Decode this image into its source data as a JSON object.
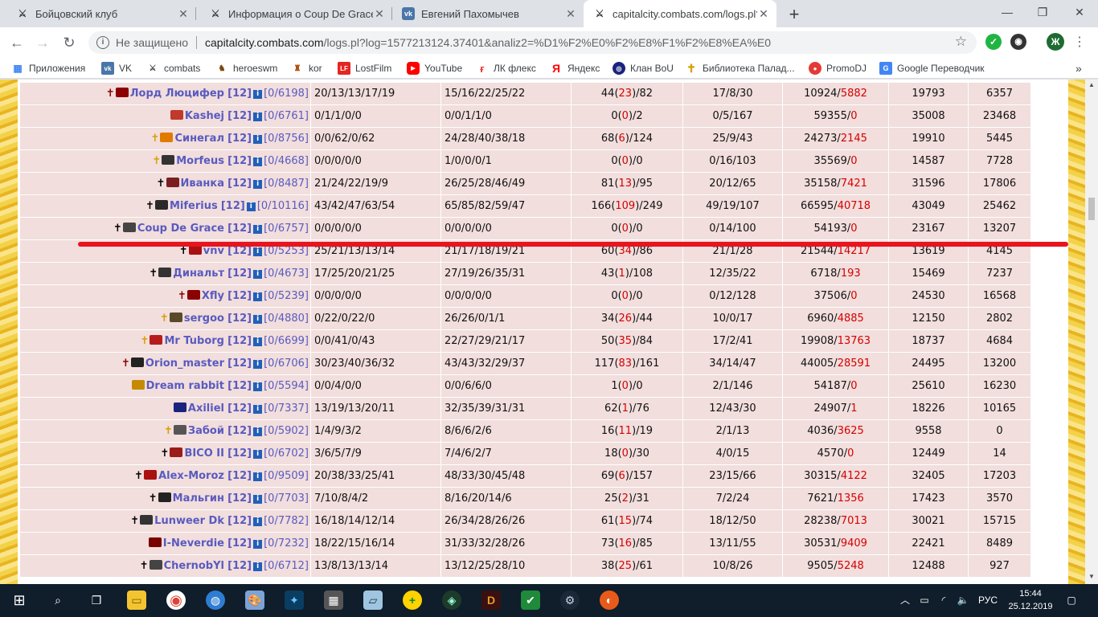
{
  "browser": {
    "tabs": [
      {
        "title": "Бойцовский клуб",
        "icon": "crossed-swords-icon"
      },
      {
        "title": "Информация о Coup De Grace",
        "icon": "crossed-swords-icon"
      },
      {
        "title": "Евгений Пахомычев",
        "icon": "vk-icon"
      },
      {
        "title": "capitalcity.combats.com/logs.pl?l",
        "icon": "crossed-swords-icon"
      }
    ],
    "new_tab": "+",
    "window_controls": [
      "—",
      "❐",
      "✕"
    ],
    "security_label": "Не защищено",
    "url_host": "capitalcity.combats.com",
    "url_path": "/logs.pl?log=1577213124.37401&analiz2=%D1%F2%E0%F2%E8%F1%F2%E8%EA%E0",
    "profile_letter": "Ж"
  },
  "bookmarks": [
    {
      "label": "Приложения",
      "icon": "apps-grid-icon"
    },
    {
      "label": "VK",
      "icon": "vk-icon"
    },
    {
      "label": "combats",
      "icon": "crossed-swords-icon"
    },
    {
      "label": "heroeswm",
      "icon": "horse-icon"
    },
    {
      "label": "kor",
      "icon": "castle-icon"
    },
    {
      "label": "LostFilm",
      "icon": "lostfilm-icon"
    },
    {
      "label": "YouTube",
      "icon": "youtube-icon"
    },
    {
      "label": "ЛК флекс",
      "icon": "flex-icon"
    },
    {
      "label": "Яндекс",
      "icon": "yandex-icon"
    },
    {
      "label": "Клан BoU",
      "icon": "clan-icon"
    },
    {
      "label": "Библиотека Палад...",
      "icon": "cross-icon"
    },
    {
      "label": "PromoDJ",
      "icon": "promodj-icon"
    },
    {
      "label": "Google Переводчик",
      "icon": "translate-icon"
    }
  ],
  "log_rows": [
    {
      "align": "✝",
      "align_color": "#8b0000",
      "login": "Лорд Люцифер",
      "level": "[12]",
      "hp": "[0/6198]",
      "s1": "20/13/13/17/19",
      "s2": "15/16/22/25/22",
      "d1": "44(",
      "d2": "23",
      "d3": ")/82",
      "kills": "17/8/30",
      "e1": "10924/",
      "e2": "5882",
      "n1": "19793",
      "n2": "6357"
    },
    {
      "align": "",
      "align_color": "#000",
      "login": "Kashej",
      "level": "[12]",
      "hp": "[0/6761]",
      "s1": "0/1/1/0/0",
      "s2": "0/0/1/1/0",
      "d1": "0(",
      "d2": "0",
      "d3": ")/2",
      "kills": "0/5/167",
      "e1": "59355/",
      "e2": "0",
      "n1": "35008",
      "n2": "23468"
    },
    {
      "align": "✝",
      "align_color": "#d8a000",
      "login": "Синегал",
      "level": "[12]",
      "hp": "[0/8756]",
      "s1": "0/0/62/0/62",
      "s2": "24/28/40/38/18",
      "d1": "68(",
      "d2": "6",
      "d3": ")/124",
      "kills": "25/9/43",
      "e1": "24273/",
      "e2": "2145",
      "n1": "19910",
      "n2": "5445"
    },
    {
      "align": "✝",
      "align_color": "#d8a000",
      "login": "Morfeus",
      "level": "[12]",
      "hp": "[0/4668]",
      "s1": "0/0/0/0/0",
      "s2": "1/0/0/0/1",
      "d1": "0(",
      "d2": "0",
      "d3": ")/0",
      "kills": "0/16/103",
      "e1": "35569/",
      "e2": "0",
      "n1": "14587",
      "n2": "7728"
    },
    {
      "align": "✝",
      "align_color": "#000",
      "login": "Иванка",
      "level": "[12]",
      "hp": "[0/8487]",
      "s1": "21/24/22/19/9",
      "s2": "26/25/28/46/49",
      "d1": "81(",
      "d2": "13",
      "d3": ")/95",
      "kills": "20/12/65",
      "e1": "35158/",
      "e2": "7421",
      "n1": "31596",
      "n2": "17806"
    },
    {
      "align": "✝",
      "align_color": "#000",
      "login": "Miferius",
      "level": "[12]",
      "hp": "[0/10116]",
      "s1": "43/42/47/63/54",
      "s2": "65/85/82/59/47",
      "d1": "166(",
      "d2": "109",
      "d3": ")/249",
      "kills": "49/19/107",
      "e1": "66595/",
      "e2": "40718",
      "n1": "43049",
      "n2": "25462"
    },
    {
      "align": "✝",
      "align_color": "#000",
      "login": "Coup De Grace",
      "level": "[12]",
      "hp": "[0/6757]",
      "s1": "0/0/0/0/0",
      "s2": "0/0/0/0/0",
      "d1": "0(",
      "d2": "0",
      "d3": ")/0",
      "kills": "0/14/100",
      "e1": "54193/",
      "e2": "0",
      "n1": "23167",
      "n2": "13207"
    },
    {
      "align": "✝",
      "align_color": "#000",
      "login": "vnv",
      "level": "[12]",
      "hp": "[0/5253]",
      "s1": "25/21/13/13/14",
      "s2": "21/17/18/19/21",
      "d1": "60(",
      "d2": "34",
      "d3": ")/86",
      "kills": "21/1/28",
      "e1": "21544/",
      "e2": "14217",
      "n1": "13619",
      "n2": "4145"
    },
    {
      "align": "✝",
      "align_color": "#000",
      "login": "Динальт",
      "level": "[12]",
      "hp": "[0/4673]",
      "s1": "17/25/20/21/25",
      "s2": "27/19/26/35/31",
      "d1": "43(",
      "d2": "1",
      "d3": ")/108",
      "kills": "12/35/22",
      "e1": "6718/",
      "e2": "193",
      "n1": "15469",
      "n2": "7237"
    },
    {
      "align": "✝",
      "align_color": "#8b0000",
      "login": "Xfly",
      "level": "[12]",
      "hp": "[0/5239]",
      "s1": "0/0/0/0/0",
      "s2": "0/0/0/0/0",
      "d1": "0(",
      "d2": "0",
      "d3": ")/0",
      "kills": "0/12/128",
      "e1": "37506/",
      "e2": "0",
      "n1": "24530",
      "n2": "16568"
    },
    {
      "align": "✝",
      "align_color": "#d8a000",
      "login": "sergoo",
      "level": "[12]",
      "hp": "[0/4880]",
      "s1": "0/22/0/22/0",
      "s2": "26/26/0/1/1",
      "d1": "34(",
      "d2": "26",
      "d3": ")/44",
      "kills": "10/0/17",
      "e1": "6960/",
      "e2": "4885",
      "n1": "12150",
      "n2": "2802"
    },
    {
      "align": "✝",
      "align_color": "#d8a000",
      "login": "Mr Tuborg",
      "level": "[12]",
      "hp": "[0/6699]",
      "s1": "0/0/41/0/43",
      "s2": "22/27/29/21/17",
      "d1": "50(",
      "d2": "35",
      "d3": ")/84",
      "kills": "17/2/41",
      "e1": "19908/",
      "e2": "13763",
      "n1": "18737",
      "n2": "4684"
    },
    {
      "align": "✝",
      "align_color": "#8b0000",
      "login": "Orion_master",
      "level": "[12]",
      "hp": "[0/6706]",
      "s1": "30/23/40/36/32",
      "s2": "43/43/32/29/37",
      "d1": "117(",
      "d2": "83",
      "d3": ")/161",
      "kills": "34/14/47",
      "e1": "44005/",
      "e2": "28591",
      "n1": "24495",
      "n2": "13200"
    },
    {
      "align": "",
      "align_color": "#000",
      "login": "Dream rabbit",
      "level": "[12]",
      "hp": "[0/5594]",
      "s1": "0/0/4/0/0",
      "s2": "0/0/6/6/0",
      "d1": "1(",
      "d2": "0",
      "d3": ")/0",
      "kills": "2/1/146",
      "e1": "54187/",
      "e2": "0",
      "n1": "25610",
      "n2": "16230"
    },
    {
      "align": "",
      "align_color": "#000",
      "login": "Axiliel",
      "level": "[12]",
      "hp": "[0/7337]",
      "s1": "13/19/13/20/11",
      "s2": "32/35/39/31/31",
      "d1": "62(",
      "d2": "1",
      "d3": ")/76",
      "kills": "12/43/30",
      "e1": "24907/",
      "e2": "1",
      "n1": "18226",
      "n2": "10165"
    },
    {
      "align": "✝",
      "align_color": "#d8a000",
      "login": "Забой",
      "level": "[12]",
      "hp": "[0/5902]",
      "s1": "1/4/9/3/2",
      "s2": "8/6/6/2/6",
      "d1": "16(",
      "d2": "11",
      "d3": ")/19",
      "kills": "2/1/13",
      "e1": "4036/",
      "e2": "3625",
      "n1": "9558",
      "n2": "0"
    },
    {
      "align": "✝",
      "align_color": "#000",
      "login": "BICO II",
      "level": "[12]",
      "hp": "[0/6702]",
      "s1": "3/6/5/7/9",
      "s2": "7/4/6/2/7",
      "d1": "18(",
      "d2": "0",
      "d3": ")/30",
      "kills": "4/0/15",
      "e1": "4570/",
      "e2": "0",
      "n1": "12449",
      "n2": "14"
    },
    {
      "align": "✝",
      "align_color": "#000",
      "login": "Alex-Moroz",
      "level": "[12]",
      "hp": "[0/9509]",
      "s1": "20/38/33/25/41",
      "s2": "48/33/30/45/48",
      "d1": "69(",
      "d2": "6",
      "d3": ")/157",
      "kills": "23/15/66",
      "e1": "30315/",
      "e2": "4122",
      "n1": "32405",
      "n2": "17203"
    },
    {
      "align": "✝",
      "align_color": "#000",
      "login": "Мальгин",
      "level": "[12]",
      "hp": "[0/7703]",
      "s1": "7/10/8/4/2",
      "s2": "8/16/20/14/6",
      "d1": "25(",
      "d2": "2",
      "d3": ")/31",
      "kills": "7/2/24",
      "e1": "7621/",
      "e2": "1356",
      "n1": "17423",
      "n2": "3570"
    },
    {
      "align": "✝",
      "align_color": "#000",
      "login": "Lunweer Dk",
      "level": "[12]",
      "hp": "[0/7782]",
      "s1": "16/18/14/12/14",
      "s2": "26/34/28/26/26",
      "d1": "61(",
      "d2": "15",
      "d3": ")/74",
      "kills": "18/12/50",
      "e1": "28238/",
      "e2": "7013",
      "n1": "30021",
      "n2": "15715"
    },
    {
      "align": "",
      "align_color": "#000",
      "login": "I-Neverdie",
      "level": "[12]",
      "hp": "[0/7232]",
      "s1": "18/22/15/16/14",
      "s2": "31/33/32/28/26",
      "d1": "73(",
      "d2": "16",
      "d3": ")/85",
      "kills": "13/11/55",
      "e1": "30531/",
      "e2": "9409",
      "n1": "22421",
      "n2": "8489"
    },
    {
      "align": "✝",
      "align_color": "#000",
      "login": "ChernobYl",
      "level": "[12]",
      "hp": "[0/6712]",
      "s1": "13/8/13/13/14",
      "s2": "13/12/25/28/10",
      "d1": "38(",
      "d2": "25",
      "d3": ")/61",
      "kills": "10/8/26",
      "e1": "9505/",
      "e2": "5248",
      "n1": "12488",
      "n2": "927"
    }
  ],
  "info_icon_label": "i",
  "taskbar": {
    "lang": "РУС",
    "time": "15:44",
    "date": "25.12.2019"
  },
  "colors": {
    "accent_red": "#d60000",
    "row_bg": "#f1dedd",
    "login_color": "#5a5abf"
  }
}
